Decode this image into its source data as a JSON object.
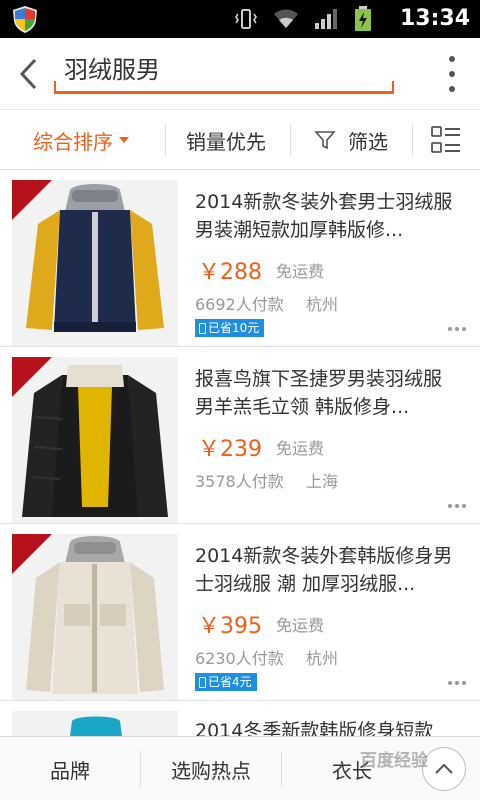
{
  "status_bar": {
    "time": "13:34"
  },
  "search": {
    "query": "羽绒服男"
  },
  "filters": {
    "sort_label": "综合排序",
    "sales_label": "销量优先",
    "filter_label": "筛选"
  },
  "products": [
    {
      "title": "2014新款冬装外套男士羽绒服男装潮短款加厚韩版修...",
      "price": "￥288",
      "shipping": "免运费",
      "sales": "6692人付款",
      "city": "杭州",
      "save": "已省10元"
    },
    {
      "title": "报喜鸟旗下圣捷罗男装羽绒服 男羊羔毛立领 韩版修身...",
      "price": "￥239",
      "shipping": "免运费",
      "sales": "3578人付款",
      "city": "上海"
    },
    {
      "title": "2014新款冬装外套韩版修身男士羽绒服 潮 加厚羽绒服...",
      "price": "￥395",
      "shipping": "免运费",
      "sales": "6230人付款",
      "city": "杭州",
      "save": "已省4元"
    },
    {
      "title": "2014冬季新款韩版修身短款"
    }
  ],
  "bottom_bar": {
    "brand_label": "品牌",
    "hot_label": "选购热点",
    "length_label": "衣长"
  },
  "watermark": "百度经验",
  "colors": {
    "accent": "#f0601a",
    "save_badge": "#1e8fe0"
  }
}
